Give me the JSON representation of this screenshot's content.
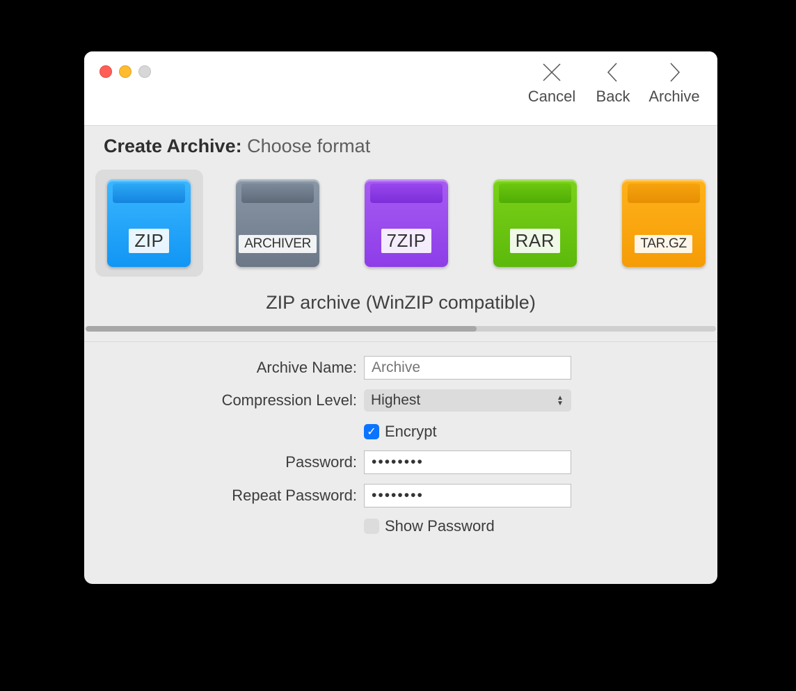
{
  "toolbar": {
    "cancel": "Cancel",
    "back": "Back",
    "archive": "Archive"
  },
  "header": {
    "title": "Create Archive:",
    "subtitle": "Choose format"
  },
  "formats": [
    {
      "id": "zip",
      "label": "ZIP",
      "selected": true
    },
    {
      "id": "archiver",
      "label": "ARCHIVER",
      "selected": false
    },
    {
      "id": "sevenzip",
      "label": "7ZIP",
      "selected": false
    },
    {
      "id": "rar",
      "label": "RAR",
      "selected": false
    },
    {
      "id": "targz",
      "label": "TAR.GZ",
      "selected": false
    }
  ],
  "description": "ZIP archive (WinZIP compatible)",
  "progress_percent": 62,
  "form": {
    "name_label": "Archive Name:",
    "name_placeholder": "Archive",
    "name_value": "",
    "level_label": "Compression Level:",
    "level_value": "Highest",
    "encrypt_label": "Encrypt",
    "encrypt_checked": true,
    "pw_label": "Password:",
    "pw_value": "••••••••",
    "rpw_label": "Repeat Password:",
    "rpw_value": "••••••••",
    "show_label": "Show Password",
    "show_checked": false
  }
}
